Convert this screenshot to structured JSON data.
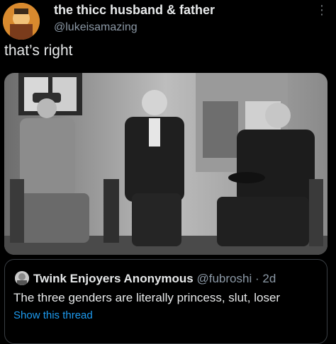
{
  "tweet": {
    "display_name": "the thicc husband & father",
    "handle": "@lukeisamazing",
    "text": "that’s right",
    "more_icon": "more-icon"
  },
  "photo": {
    "icon": "black-and-white-photo-three-seated-men"
  },
  "quote": {
    "display_name": "Twink Enjoyers Anonymous",
    "handle": "@fubroshi",
    "separator": "·",
    "time": "2d",
    "text": "The three genders are literally princess, slut, loser",
    "show_thread": "Show this thread"
  },
  "colors": {
    "background": "#000000",
    "primary_text": "#e7e9ea",
    "secondary_text": "#8b98a5",
    "link": "#1d9bf0"
  }
}
